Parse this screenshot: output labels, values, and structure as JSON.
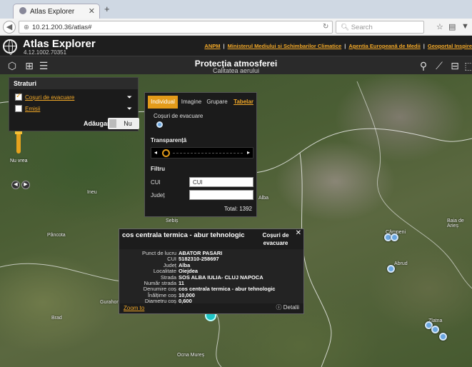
{
  "browser": {
    "tab_title": "Atlas Explorer",
    "url": "10.21.200.36/atlas#",
    "search_placeholder": "Search"
  },
  "app": {
    "title": "Atlas Explorer",
    "version": "4.12.1002.70351",
    "links": [
      "ANPM",
      "Ministerul Mediului si Schimbarilor Climatice",
      "Agentia Europeană de Medii",
      "Geoportal Inspire"
    ],
    "page_title": "Protecția atmosferei",
    "page_subtitle": "Calitatea aerului"
  },
  "layers": {
    "header": "Straturi",
    "items": [
      {
        "label": "Coșuri de evacuare",
        "checked": true
      },
      {
        "label": "Emisii",
        "checked": false
      }
    ],
    "add_label": "Adăugare",
    "toggle_value": "Nu"
  },
  "filter": {
    "tabs": [
      "Individual",
      "Imagine",
      "Grupare",
      "Tabelar"
    ],
    "legend_label": "Coșuri de evacuare",
    "transparency_label": "Transparență",
    "filter_label": "Filtru",
    "cui_label": "CUI",
    "cui_value": "CUI",
    "judet_label": "Județ",
    "judet_value": "",
    "total_text": "Total: 1392"
  },
  "popup": {
    "title": "cos centrala termica - abur tehnologic",
    "layer": "Coșuri de evacuare",
    "rows": [
      {
        "key": "Punct de lucru",
        "value": "ABATOR PASARI"
      },
      {
        "key": "CUI",
        "value": "5182310-258697"
      },
      {
        "key": "Județ",
        "value": "Alba"
      },
      {
        "key": "Localitate",
        "value": "Oiejdea"
      },
      {
        "key": "Strada",
        "value": "SOS ALBA IULIA- CLUJ NAPOCA"
      },
      {
        "key": "Număr strada",
        "value": "11"
      },
      {
        "key": "Denumire coș",
        "value": "cos centrala termica - abur tehnologic"
      },
      {
        "key": "Înălțime coș",
        "value": "10,000"
      },
      {
        "key": "Diametru coș",
        "value": "0,600"
      }
    ],
    "zoom_label": "Zoom to",
    "details_label": "Detalii"
  },
  "map": {
    "places": [
      "Ineu",
      "Sebiș",
      "Pâncota",
      "Gurahonț",
      "Alba",
      "Câmpeni",
      "Abrud",
      "Baia de Arieș",
      "Zlatna",
      "Brad",
      "Ocna Mureș"
    ],
    "overlay_label": "Nu vrea"
  },
  "colors": {
    "accent": "#e39b1a",
    "link": "#f3a928",
    "marker": "#6aa6e0"
  }
}
